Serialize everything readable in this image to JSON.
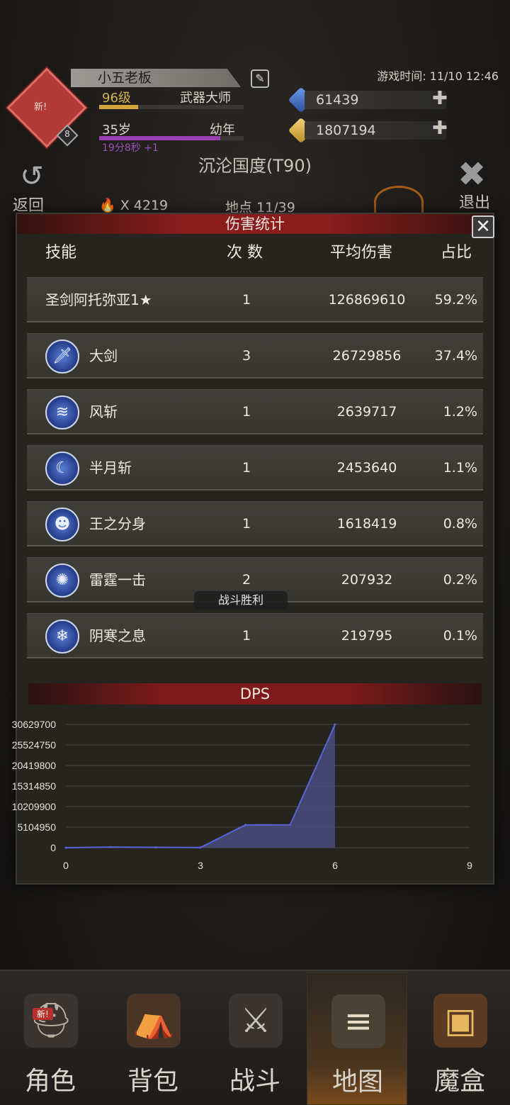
{
  "player": {
    "avatar_mark": "新!",
    "avatar_level": "8",
    "name": "小五老板",
    "level": "96级",
    "title": "武器大师",
    "age": "35岁",
    "stage": "幼年",
    "timer": "19分8秒 +1",
    "xp_fraction": 0.27,
    "age_fraction": 0.84
  },
  "game_time": "游戏时间: 11/10 12:46",
  "resources": {
    "gems": "61439",
    "gold": "1807194"
  },
  "realm_title": "沉沦国度(T90)",
  "nav_top": {
    "back_label": "返回",
    "exit_label": "退出",
    "kill_count": "X 4219",
    "location": "地点 11/39"
  },
  "panel": {
    "title": "伤害统计",
    "close_glyph": "✕",
    "columns": {
      "skill": "技能",
      "count": "次 数",
      "avg": "平均伤害",
      "ratio": "占比"
    },
    "rows": [
      {
        "name": "圣剑阿托弥亚1★",
        "count": "1",
        "avg": "126869610",
        "ratio": "59.2%",
        "icon": ""
      },
      {
        "name": "大剑",
        "count": "3",
        "avg": "26729856",
        "ratio": "37.4%",
        "icon": "sword-icon"
      },
      {
        "name": "风斩",
        "count": "1",
        "avg": "2639717",
        "ratio": "1.2%",
        "icon": "wind-slash-icon"
      },
      {
        "name": "半月斩",
        "count": "1",
        "avg": "2453640",
        "ratio": "1.1%",
        "icon": "crescent-icon"
      },
      {
        "name": "王之分身",
        "count": "1",
        "avg": "1618419",
        "ratio": "0.8%",
        "icon": "clone-icon"
      },
      {
        "name": "雷霆一击",
        "count": "2",
        "avg": "207932",
        "ratio": "0.2%",
        "icon": "thunder-icon"
      },
      {
        "name": "阴寒之息",
        "count": "1",
        "avg": "219795",
        "ratio": "0.1%",
        "icon": "frost-breath-icon"
      }
    ],
    "toast": "战斗胜利",
    "dps_title": "DPS"
  },
  "chart_data": {
    "type": "area",
    "title": "DPS",
    "x": [
      0,
      1,
      2,
      3,
      4,
      5,
      6
    ],
    "values": [
      0,
      150000,
      80000,
      50000,
      5650000,
      5700000,
      30629700
    ],
    "xlim": [
      0,
      9
    ],
    "ylim": [
      0,
      30629700
    ],
    "x_ticks": [
      "0",
      "3",
      "6",
      "9"
    ],
    "y_ticks": [
      "0",
      "5104950",
      "10209900",
      "15314850",
      "20419800",
      "25524750",
      "30629700"
    ],
    "grid": true,
    "colors": {
      "line": "#5a64d8",
      "fill": "#4a4c80"
    }
  },
  "bottom_nav": [
    {
      "label": "角色",
      "icon": "helmet-icon",
      "glyph": "⛑",
      "badge": "新!"
    },
    {
      "label": "背包",
      "icon": "backpack-icon",
      "glyph": "🎒",
      "badge": ""
    },
    {
      "label": "战斗",
      "icon": "sword-shield-icon",
      "glyph": "⚔",
      "badge": ""
    },
    {
      "label": "地图",
      "icon": "scroll-map-icon",
      "glyph": "📜",
      "badge": ""
    },
    {
      "label": "魔盒",
      "icon": "magic-box-icon",
      "glyph": "▣",
      "badge": ""
    }
  ]
}
